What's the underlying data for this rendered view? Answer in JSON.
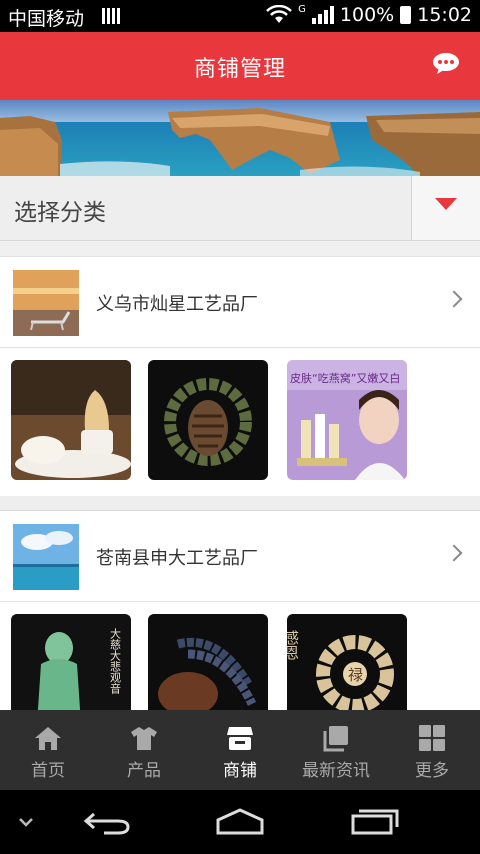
{
  "status_bar": {
    "carrier": "中国移动",
    "network_type": "G",
    "battery_percent": "100%",
    "time": "15:02"
  },
  "header": {
    "title": "商铺管理",
    "chat_icon": "chat-bubble-icon"
  },
  "filter": {
    "label": "选择分类",
    "dropdown_icon": "triangle-down-icon"
  },
  "shops": [
    {
      "name": "义乌市灿星工艺品厂",
      "thumbnail": "beach-lounger-photo",
      "products": [
        {
          "image": "coconut-dessert-photo"
        },
        {
          "image": "agarwood-bead-photo"
        },
        {
          "image": "cosmetics-ad-photo",
          "ad_text": "皮肤“吃燕窝”又嫩又白"
        }
      ]
    },
    {
      "name": "苍南县申大工艺品厂",
      "thumbnail": "sea-sky-photo",
      "products": [
        {
          "image": "jade-guanyin-photo",
          "text": "大慈大悲观音"
        },
        {
          "image": "bead-bracelet-teapot-photo"
        },
        {
          "image": "buddha-beads-photo",
          "text": "感恩",
          "bead_text": "禄"
        }
      ]
    }
  ],
  "tab_bar": {
    "items": [
      {
        "label": "首页",
        "icon": "home-icon",
        "active": false
      },
      {
        "label": "产品",
        "icon": "tshirt-icon",
        "active": false
      },
      {
        "label": "商铺",
        "icon": "store-icon",
        "active": true
      },
      {
        "label": "最新资讯",
        "icon": "news-icon",
        "active": false
      },
      {
        "label": "更多",
        "icon": "grid-icon",
        "active": false
      }
    ]
  },
  "colors": {
    "accent": "#e8383e",
    "tab_bar_bg": "#2f2f2f",
    "tab_active": "#ffffff",
    "tab_inactive": "#a9a9a9"
  }
}
